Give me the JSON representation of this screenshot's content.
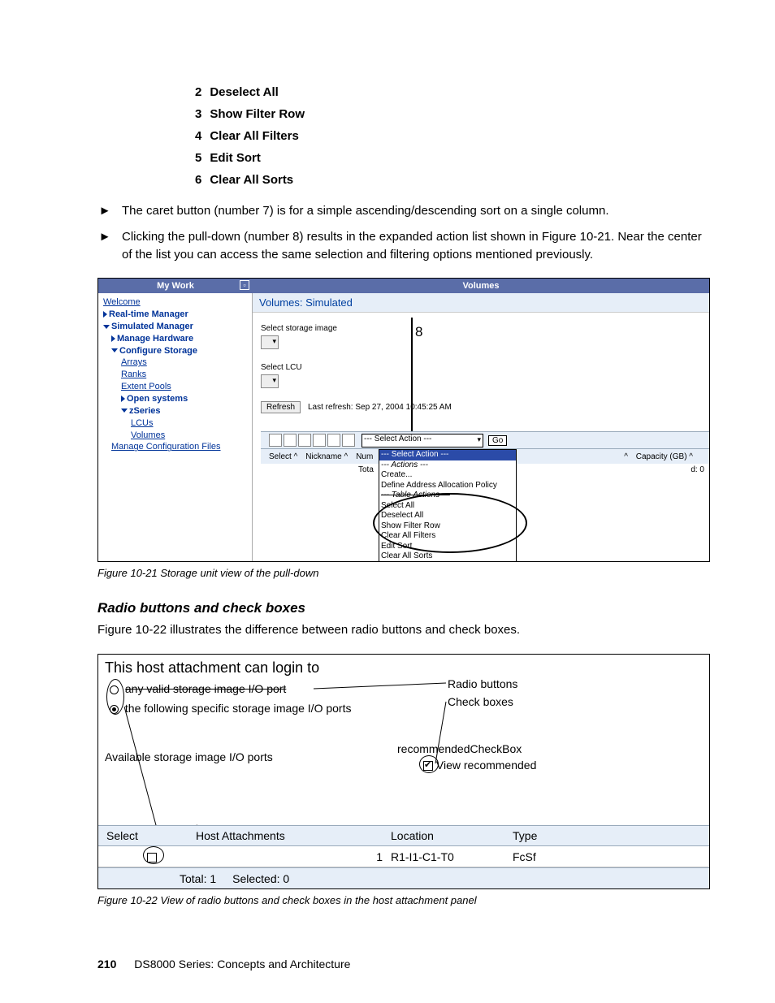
{
  "numbered_list": [
    {
      "n": "2",
      "txt": "Deselect All"
    },
    {
      "n": "3",
      "txt": "Show Filter Row"
    },
    {
      "n": "4",
      "txt": "Clear All Filters"
    },
    {
      "n": "5",
      "txt": "Edit Sort"
    },
    {
      "n": "6",
      "txt": "Clear All Sorts"
    }
  ],
  "bullets": [
    "The caret button (number 7) is for a simple ascending/descending sort on a single column.",
    "Clicking the pull-down (number 8) results in the expanded action list shown in Figure 10-21. Near the center of the list you can access the same selection and filtering options mentioned previously."
  ],
  "fig1": {
    "mywork": "My Work",
    "volumes": "Volumes",
    "sidebar": {
      "welcome": "Welcome",
      "rtm": "Real-time Manager",
      "sim": "Simulated Manager",
      "mh": "Manage Hardware",
      "cs": "Configure Storage",
      "arrays": "Arrays",
      "ranks": "Ranks",
      "ep": "Extent Pools",
      "os": "Open systems",
      "zs": "zSeries",
      "lcus": "LCUs",
      "vols": "Volumes",
      "mcf": "Manage Configuration Files"
    },
    "content": {
      "title": "Volumes: Simulated",
      "ssi": "Select storage image",
      "slcu": "Select LCU",
      "refresh": "Refresh",
      "lastref": "Last refresh: Sep 27, 2004 10:45:25 AM",
      "selact": "--- Select Action ---",
      "go": "Go",
      "col_select": "Select ^",
      "col_nick": "Nickname ^",
      "col_num": "Num",
      "col_cap": "Capacity (GB) ^",
      "tota": "Tota",
      "d0": "d: 0",
      "caret": "^",
      "dropdown": [
        {
          "t": "--- Select Action ---",
          "cls": "hl"
        },
        {
          "t": "--- Actions ---",
          "cls": "it"
        },
        {
          "t": "Create...",
          "cls": ""
        },
        {
          "t": "Define Address Allocation Policy",
          "cls": ""
        },
        {
          "t": "--- Table Actions ---",
          "cls": "it"
        },
        {
          "t": "Select All",
          "cls": ""
        },
        {
          "t": "Deselect All",
          "cls": ""
        },
        {
          "t": "Show Filter Row",
          "cls": ""
        },
        {
          "t": "Clear All Filters",
          "cls": ""
        },
        {
          "t": "Edit Sort",
          "cls": ""
        },
        {
          "t": "Clear All Sorts",
          "cls": ""
        }
      ],
      "num8": "8"
    },
    "caption": "Figure 10-21   Storage unit view of the pull-down"
  },
  "section_head": "Radio buttons and check boxes",
  "section_text": "Figure 10-22 illustrates the difference between radio buttons and check boxes.",
  "fig2": {
    "login": "This host attachment can login to",
    "opt1": "any valid storage image I/O port",
    "opt2": "the following specific storage image I/O ports",
    "avail": "Available storage image I/O ports",
    "recchk": "recommendedCheckBox",
    "viewrec": "View recommended",
    "radio_lbl": "Radio buttons",
    "check_lbl": "Check boxes",
    "hdr": {
      "c1": "Select",
      "c2": "Host Attachments",
      "c3": "Location",
      "c4": "Type"
    },
    "row": {
      "c2": "1",
      "c3": "R1-I1-C1-T0",
      "c4": "FcSf"
    },
    "foot": {
      "tot": "Total: 1",
      "sel": "Selected: 0"
    },
    "caption": "Figure 10-22   View of radio buttons and check boxes in the host attachment panel"
  },
  "footer": {
    "page": "210",
    "title": "DS8000 Series: Concepts and Architecture"
  }
}
